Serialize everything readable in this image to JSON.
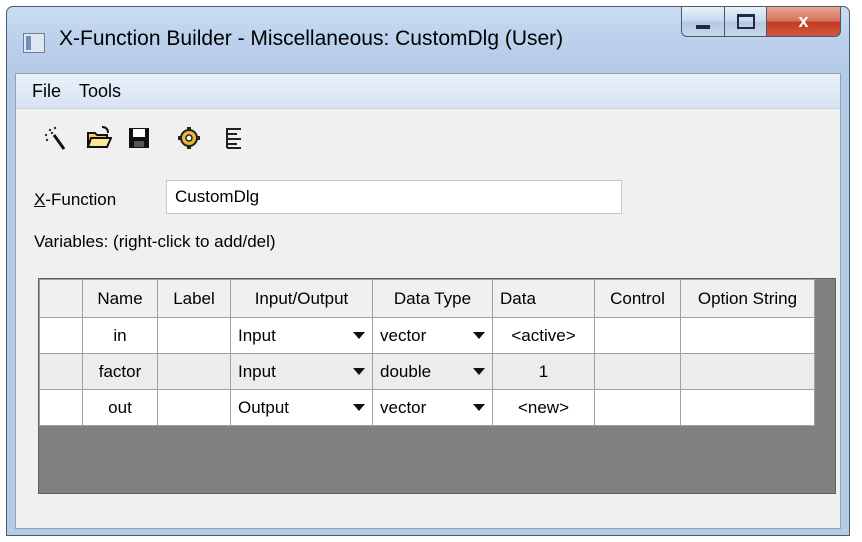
{
  "window": {
    "title": "X-Function Builder - Miscellaneous: CustomDlg (User)",
    "close_glyph": "x"
  },
  "menu": {
    "items": [
      "File",
      "Tools"
    ]
  },
  "toolbar": {
    "icons": [
      "wand-icon",
      "open-folder-icon",
      "save-disk-icon",
      "gear-settings-icon",
      "tree-view-icon"
    ]
  },
  "xfunction": {
    "label_mnemonic": "X",
    "label_rest": "-Function",
    "value": "CustomDlg"
  },
  "variables_label": "Variables: (right-click to add/del)",
  "table": {
    "headers": [
      "Name",
      "Label",
      "Input/Output",
      "Data Type",
      "Data",
      "Control",
      "Option String"
    ],
    "rows": [
      {
        "name": "in",
        "label": "",
        "io": "Input",
        "dtype": "vector",
        "data": "<active>",
        "control": "",
        "option": ""
      },
      {
        "name": "factor",
        "label": "",
        "io": "Input",
        "dtype": "double",
        "data": "1",
        "control": "",
        "option": ""
      },
      {
        "name": "out",
        "label": "",
        "io": "Output",
        "dtype": "vector",
        "data": "<new>",
        "control": "",
        "option": ""
      }
    ]
  },
  "colors": {
    "titlebar": "#b9cfea",
    "close_button": "#c0391f",
    "grid_empty": "#808080"
  }
}
